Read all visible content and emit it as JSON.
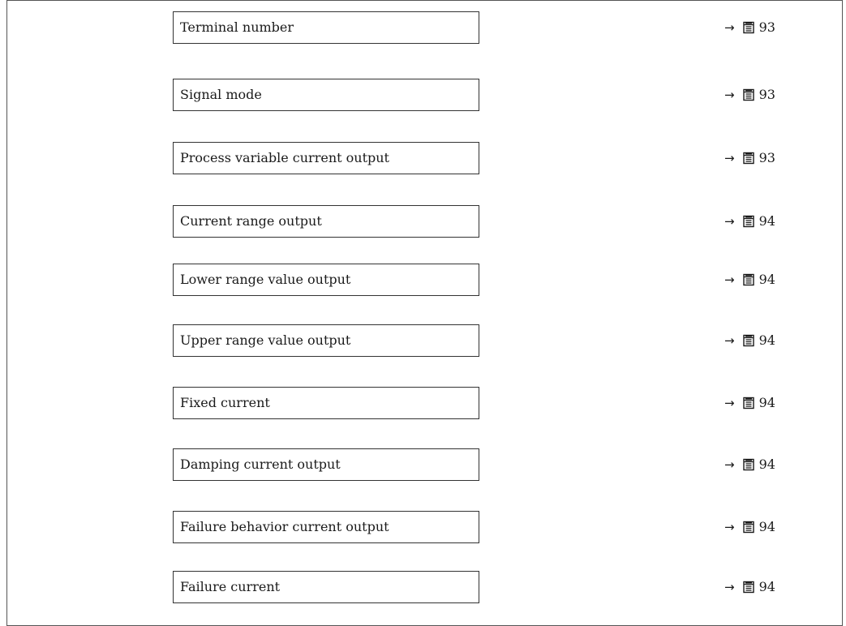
{
  "parameters": [
    {
      "label": "Terminal number",
      "page": "93"
    },
    {
      "label": "Signal mode",
      "page": "93"
    },
    {
      "label": "Process variable current output",
      "page": "93"
    },
    {
      "label": "Current range output",
      "page": "94"
    },
    {
      "label": "Lower range value output",
      "page": "94"
    },
    {
      "label": "Upper range value output",
      "page": "94"
    },
    {
      "label": "Fixed current",
      "page": "94"
    },
    {
      "label": "Damping current output",
      "page": "94"
    },
    {
      "label": "Failure behavior current output",
      "page": "94"
    },
    {
      "label": "Failure current",
      "page": "94"
    }
  ],
  "arrow_symbol": "→",
  "page_icon": "book-page-icon"
}
